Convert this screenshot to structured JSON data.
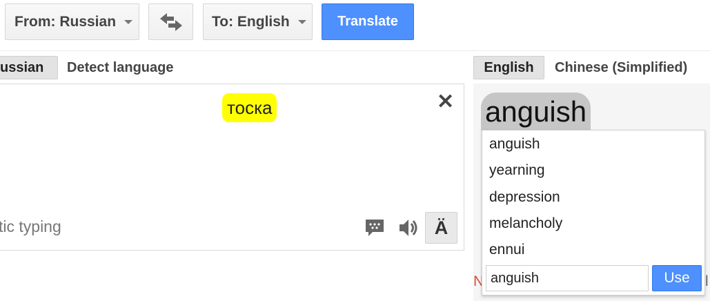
{
  "toolbar": {
    "from_label": "From: Russian",
    "to_label": "To: English",
    "translate_label": "Translate"
  },
  "source": {
    "tabs": [
      "ussian",
      "Detect language"
    ],
    "selected_tab": "ussian",
    "text": "тоска",
    "input_tools_text": "tic typing",
    "virtual_keyboard_glyph": "Ä"
  },
  "target": {
    "tabs": [
      "English",
      "Chinese (Simplified)"
    ],
    "selected_tab": "English",
    "highlighted_word": "anguish",
    "alternatives": [
      "anguish",
      "yearning",
      "depression",
      "melancholy",
      "ennui"
    ],
    "edit_value": "anguish",
    "use_label": "Use",
    "behind_text_left": "N",
    "behind_text_right": "l"
  },
  "colors": {
    "accent_blue": "#4d90fe",
    "highlight_yellow": "#ffff00",
    "behind_text_red": "#dd4b39"
  }
}
